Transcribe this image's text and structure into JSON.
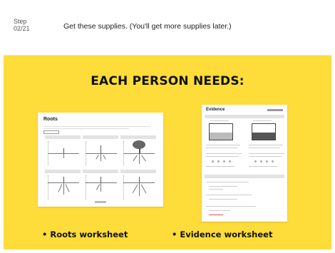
{
  "step": {
    "label": "Step",
    "number": "02/21",
    "instruction": "Get these supplies. (You'll get more supplies later.)"
  },
  "panel": {
    "background": "#fedc3a",
    "title": "EACH PERSON NEEDS:"
  },
  "supplies": [
    {
      "label": "• Roots worksheet",
      "worksheet_title": "Roots"
    },
    {
      "label": "• Evidence worksheet",
      "worksheet_title": "Evidence"
    }
  ]
}
